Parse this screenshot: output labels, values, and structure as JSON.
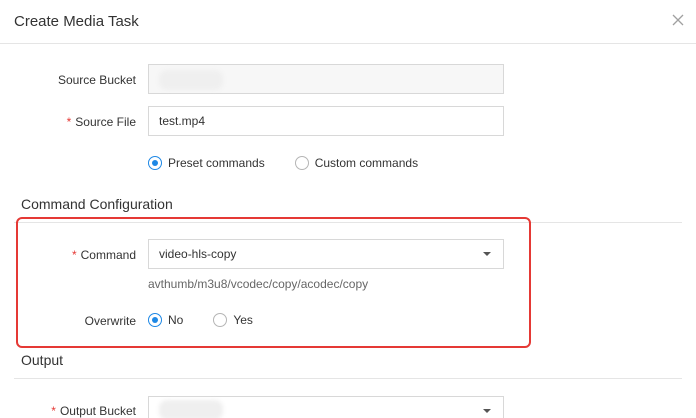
{
  "dialog": {
    "title": "Create Media Task"
  },
  "form": {
    "source_bucket": {
      "label": "Source Bucket",
      "value": ""
    },
    "source_file": {
      "label": "Source File",
      "value": "test.mp4",
      "required_mark": "*"
    },
    "mode": {
      "options": [
        "Preset commands",
        "Custom commands"
      ],
      "selected": "Preset commands"
    }
  },
  "command_config": {
    "title": "Command Configuration",
    "command": {
      "label": "Command",
      "value": "video-hls-copy",
      "required_mark": "*",
      "hint": "avthumb/m3u8/vcodec/copy/acodec/copy"
    },
    "overwrite": {
      "label": "Overwrite",
      "options": [
        "No",
        "Yes"
      ],
      "selected": "No"
    }
  },
  "output": {
    "title": "Output",
    "output_bucket": {
      "label": "Output Bucket",
      "value": "",
      "required_mark": "*"
    }
  },
  "colors": {
    "accent": "#1e88e5",
    "required": "#e53935",
    "highlight_border": "#e53935"
  }
}
